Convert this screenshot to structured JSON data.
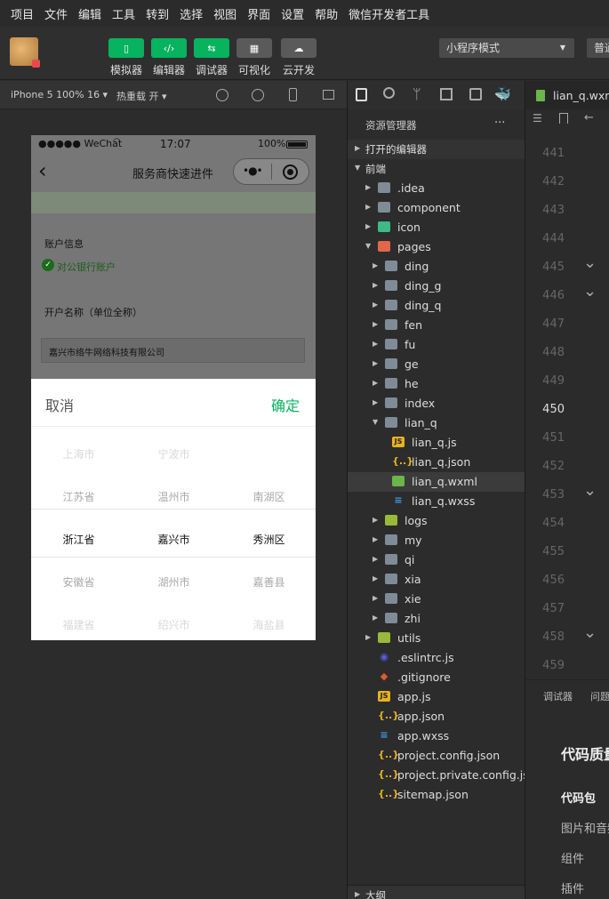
{
  "menubar": {
    "items": [
      "项目",
      "文件",
      "编辑",
      "工具",
      "转到",
      "选择",
      "视图",
      "界面",
      "设置",
      "帮助",
      "微信开发者工具"
    ]
  },
  "toolbar": {
    "buttons": [
      {
        "label": "模拟器",
        "glyph": "▯"
      },
      {
        "label": "编辑器",
        "glyph": "‹/›"
      },
      {
        "label": "调试器",
        "glyph": "⇆"
      },
      {
        "label": "可视化",
        "glyph": "▦"
      },
      {
        "label": "云开发",
        "glyph": "☁"
      }
    ],
    "mode": "小程序模式",
    "compile": "普通"
  },
  "simbar": {
    "device": "iPhone 5 100% 16 ▾",
    "hotreload": "热重载 开 ▾"
  },
  "phone": {
    "status_left": "●●●●● WeChat",
    "time": "17:07",
    "battery": "100%",
    "nav_title": "服务商快速进件",
    "account_info": "账户信息",
    "account_type": "对公银行账户",
    "account_name_label": "开户名称（单位全称）",
    "account_name_value": "嘉兴市络牛网络科技有限公司",
    "cancel": "取消",
    "confirm": "确定",
    "picker_rows": [
      [
        "上海市",
        "宁波市",
        ""
      ],
      [
        "江苏省",
        "温州市",
        "南湖区"
      ],
      [
        "浙江省",
        "嘉兴市",
        "秀洲区"
      ],
      [
        "安徽省",
        "湖州市",
        "嘉善县"
      ],
      [
        "福建省",
        "绍兴市",
        "海盐县"
      ]
    ]
  },
  "explorer": {
    "title": "资源管理器",
    "more": "···",
    "open_editors": "打开的编辑器",
    "project": "前端",
    "tree": [
      {
        "label": ".idea",
        "type": "folder",
        "depth": 1
      },
      {
        "label": "component",
        "type": "folder",
        "depth": 1
      },
      {
        "label": "icon",
        "type": "folder",
        "depth": 1
      },
      {
        "label": "pages",
        "type": "folder-open",
        "depth": 1
      },
      {
        "label": "ding",
        "type": "folder",
        "depth": 2
      },
      {
        "label": "ding_g",
        "type": "folder",
        "depth": 2
      },
      {
        "label": "ding_q",
        "type": "folder",
        "depth": 2
      },
      {
        "label": "fen",
        "type": "folder",
        "depth": 2
      },
      {
        "label": "fu",
        "type": "folder",
        "depth": 2
      },
      {
        "label": "ge",
        "type": "folder",
        "depth": 2
      },
      {
        "label": "he",
        "type": "folder",
        "depth": 2
      },
      {
        "label": "index",
        "type": "folder",
        "depth": 2
      },
      {
        "label": "lian_q",
        "type": "folder-open",
        "depth": 2
      },
      {
        "label": "lian_q.js",
        "type": "js",
        "depth": 3
      },
      {
        "label": "lian_q.json",
        "type": "json",
        "depth": 3
      },
      {
        "label": "lian_q.wxml",
        "type": "wxml",
        "depth": 3,
        "selected": true
      },
      {
        "label": "lian_q.wxss",
        "type": "wxss",
        "depth": 3
      },
      {
        "label": "logs",
        "type": "folder",
        "depth": 2
      },
      {
        "label": "my",
        "type": "folder",
        "depth": 2
      },
      {
        "label": "qi",
        "type": "folder",
        "depth": 2
      },
      {
        "label": "xia",
        "type": "folder",
        "depth": 2
      },
      {
        "label": "xie",
        "type": "folder",
        "depth": 2
      },
      {
        "label": "zhi",
        "type": "folder",
        "depth": 2
      },
      {
        "label": "utils",
        "type": "folder",
        "depth": 1
      },
      {
        "label": ".eslintrc.js",
        "type": "eslint",
        "depth": 1
      },
      {
        "label": ".gitignore",
        "type": "git",
        "depth": 1
      },
      {
        "label": "app.js",
        "type": "js",
        "depth": 1
      },
      {
        "label": "app.json",
        "type": "json",
        "depth": 1
      },
      {
        "label": "app.wxss",
        "type": "wxss",
        "depth": 1
      },
      {
        "label": "project.config.json",
        "type": "json",
        "depth": 1
      },
      {
        "label": "project.private.config.js...",
        "type": "json",
        "depth": 1
      },
      {
        "label": "sitemap.json",
        "type": "json",
        "depth": 1
      }
    ],
    "outline": "大纲"
  },
  "editor": {
    "tab": "lian_q.wxml",
    "lines": [
      "441",
      "442",
      "443",
      "444",
      "445",
      "446",
      "447",
      "448",
      "449",
      "450",
      "451",
      "452",
      "453",
      "454",
      "455",
      "456",
      "457",
      "458",
      "459"
    ],
    "current_line": "450",
    "bottom_tabs": [
      "调试器",
      "问题"
    ],
    "quality_title": "代码质量",
    "bottom_items": [
      "代码包",
      "图片和音频",
      "组件",
      "插件"
    ]
  },
  "colors": {
    "accent_green": "#07b35f",
    "selected_row": "#3b3b3b"
  }
}
